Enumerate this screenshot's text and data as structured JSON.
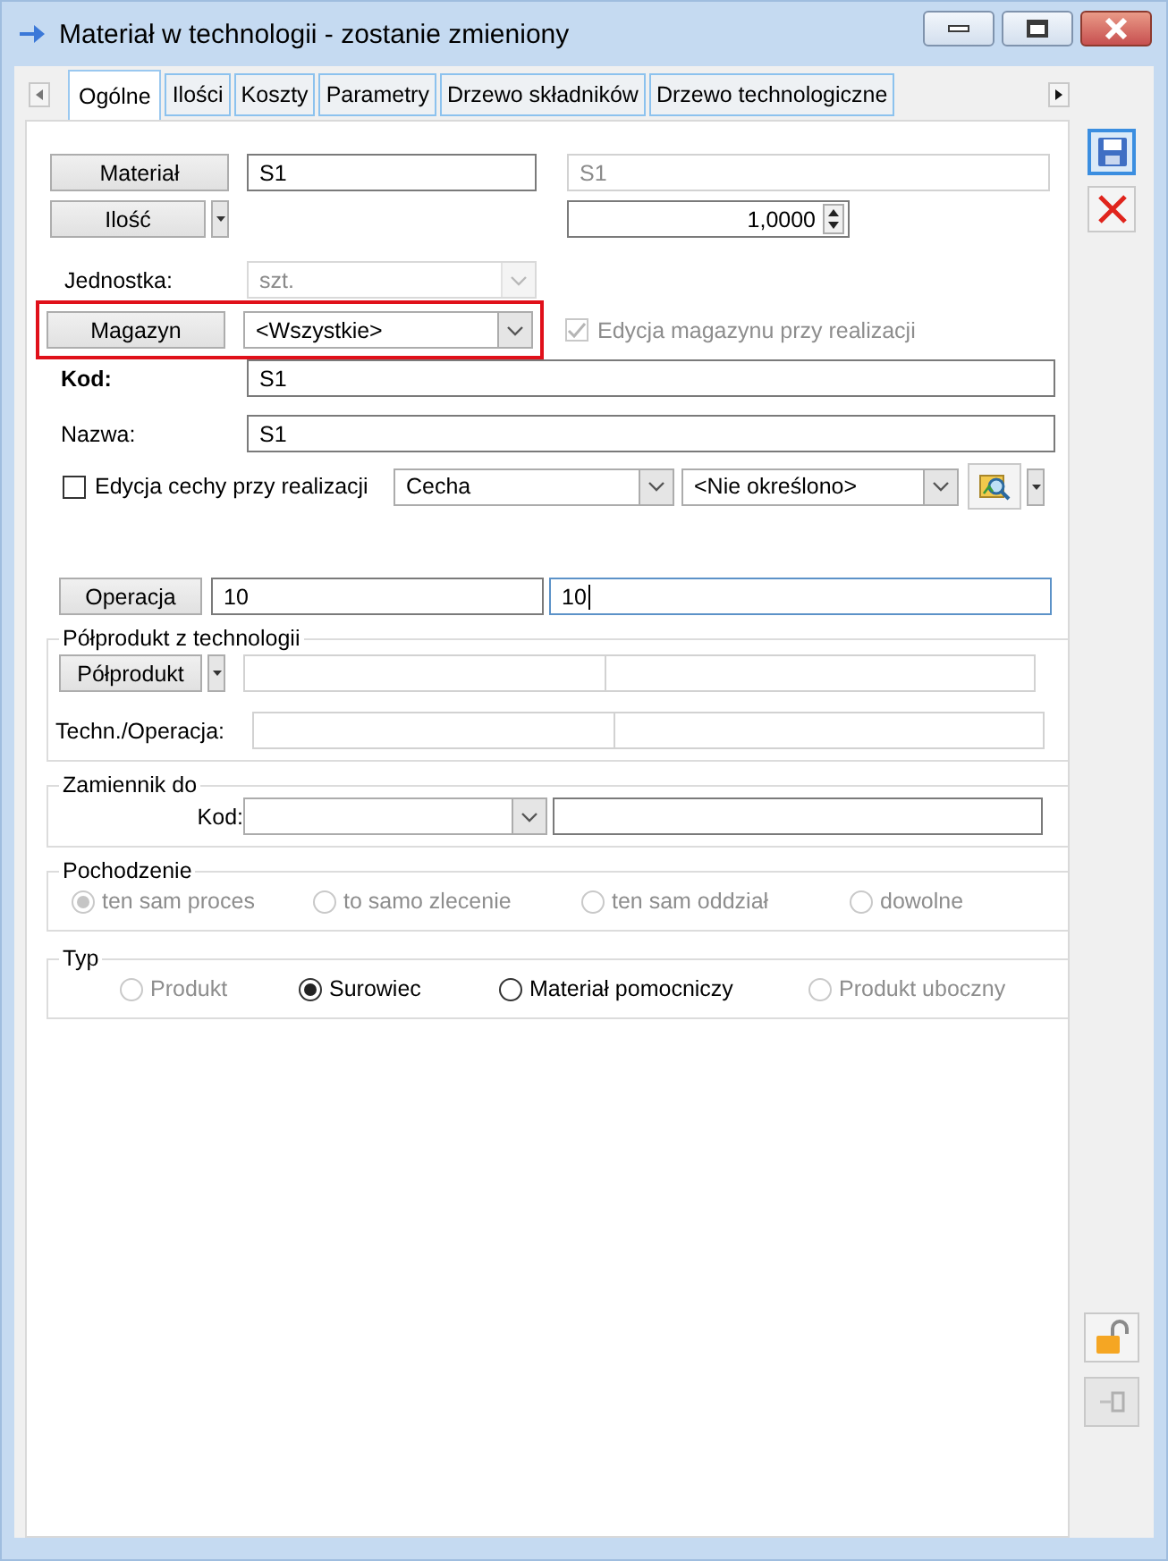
{
  "window": {
    "title": "Materiał w technologii - zostanie zmieniony"
  },
  "tabs": [
    {
      "label": "Ogólne",
      "selected": true
    },
    {
      "label": "Ilości",
      "selected": false
    },
    {
      "label": "Koszty",
      "selected": false
    },
    {
      "label": "Parametry",
      "selected": false
    },
    {
      "label": "Drzewo składników",
      "selected": false
    },
    {
      "label": "Drzewo technologiczne",
      "selected": false
    }
  ],
  "material": {
    "button": "Materiał",
    "code": "S1",
    "name": "S1"
  },
  "quantity": {
    "button": "Ilość",
    "value": "1,0000"
  },
  "unit": {
    "label": "Jednostka:",
    "value": "szt.",
    "disabled": true
  },
  "warehouse": {
    "button": "Magazyn",
    "value": "<Wszystkie>",
    "highlighted": true,
    "edit_checkbox": {
      "label": "Edycja magazynu przy realizacji",
      "checked": true,
      "disabled": true
    }
  },
  "code": {
    "label": "Kod:",
    "value": "S1"
  },
  "name": {
    "label": "Nazwa:",
    "value": "S1"
  },
  "feature": {
    "checkbox": {
      "label": "Edycja cechy przy realizacji",
      "checked": false,
      "disabled": false
    },
    "feature": "Cecha",
    "value": "<Nie określono>"
  },
  "operation": {
    "button": "Operacja",
    "fields": [
      {
        "value": "10",
        "focused": false
      },
      {
        "value": "10",
        "focused": true
      }
    ]
  },
  "semi_product": {
    "title": "Półprodukt z technologii",
    "button": "Półprodukt",
    "tech_label": "Techn./Operacja:"
  },
  "substitute": {
    "title": "Zamiennik do",
    "code_label": "Kod:"
  },
  "origin": {
    "title": "Pochodzenie",
    "options": [
      {
        "label": "ten sam proces",
        "selected": true,
        "disabled": true
      },
      {
        "label": "to samo zlecenie",
        "selected": false,
        "disabled": true
      },
      {
        "label": "ten sam oddział",
        "selected": false,
        "disabled": true
      },
      {
        "label": "dowolne",
        "selected": false,
        "disabled": true
      }
    ]
  },
  "type": {
    "title": "Typ",
    "options": [
      {
        "label": "Produkt",
        "selected": false,
        "disabled": true
      },
      {
        "label": "Surowiec",
        "selected": true,
        "disabled": false
      },
      {
        "label": "Materiał pomocniczy",
        "selected": false,
        "disabled": false
      },
      {
        "label": "Produkt uboczny",
        "selected": false,
        "disabled": true
      }
    ]
  }
}
